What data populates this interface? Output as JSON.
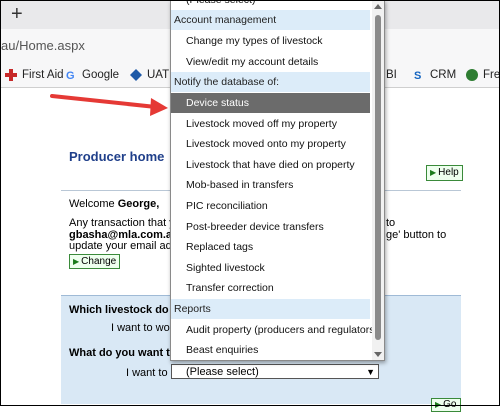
{
  "browser": {
    "new_tab_glyph": "+",
    "url_fragment": "au/Home.aspx",
    "bookmarks": [
      {
        "label": "First Aid",
        "icon": "plus-icon",
        "color": "#c62828"
      },
      {
        "label": "Google",
        "icon": "google-icon",
        "color": "#4285f4"
      },
      {
        "label": "UAT",
        "icon": "diamond-icon",
        "color": "#1e5aa8"
      },
      {
        "label": "BI",
        "icon": "bi-icon",
        "color": "#444444"
      },
      {
        "label": "CRM",
        "icon": "crm-icon",
        "color": "#1565c0"
      },
      {
        "label": "Fres",
        "icon": "fresh-icon",
        "color": "#2e7d32"
      }
    ]
  },
  "page": {
    "title": "Producer home",
    "help_label": "Help",
    "welcome_prefix": "Welcome ",
    "welcome_name": "George,",
    "intro_line1": "Any transaction that you",
    "intro_line1_right": "to",
    "intro_email": "gbasha@mla.com.au.",
    "intro_line2_right": "ge' button to",
    "intro_line3": "update your email addre",
    "change_label": "Change",
    "question1": "Which livestock do yo",
    "question1_answer": "I want to work",
    "question2": "What do you want to",
    "question2_answer": "I want to",
    "select_value": "(Please select)",
    "go_label": "Go"
  },
  "dropdown": {
    "items": [
      {
        "label": "(Please select)",
        "kind": "option"
      },
      {
        "label": "Account management",
        "kind": "group"
      },
      {
        "label": "Change my types of livestock",
        "kind": "option"
      },
      {
        "label": "View/edit my account details",
        "kind": "option"
      },
      {
        "label": "Notify the database of:",
        "kind": "group"
      },
      {
        "label": "Device status",
        "kind": "selected"
      },
      {
        "label": "Livestock moved off my property",
        "kind": "option"
      },
      {
        "label": "Livestock moved onto my property",
        "kind": "option"
      },
      {
        "label": "Livestock that have died on property",
        "kind": "option"
      },
      {
        "label": "Mob-based in transfers",
        "kind": "option"
      },
      {
        "label": "PIC reconciliation",
        "kind": "option"
      },
      {
        "label": "Post-breeder device transfers",
        "kind": "option"
      },
      {
        "label": "Replaced tags",
        "kind": "option"
      },
      {
        "label": "Sighted livestock",
        "kind": "option"
      },
      {
        "label": "Transfer correction",
        "kind": "option"
      },
      {
        "label": "Reports",
        "kind": "group"
      },
      {
        "label": "Audit property (producers and regulators)",
        "kind": "option"
      },
      {
        "label": "Beast enquiries",
        "kind": "option"
      }
    ]
  },
  "colors": {
    "title_blue": "#1f3f8a",
    "group_bg": "#dcecf9",
    "selected_bg": "#6b6b6b",
    "arrow_red": "#e53935"
  }
}
